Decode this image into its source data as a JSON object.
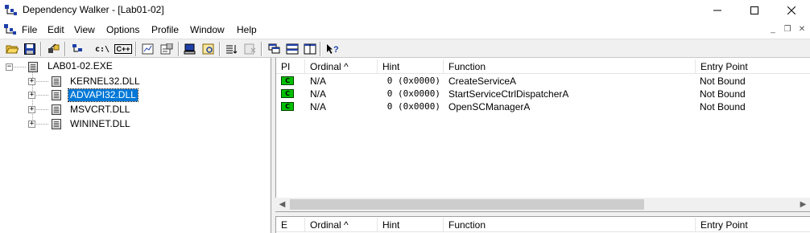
{
  "window": {
    "title": "Dependency Walker - [Lab01-02]",
    "minimize_icon": "minimize-icon",
    "maximize_icon": "maximize-icon",
    "close_icon": "close-icon"
  },
  "menu": {
    "items": [
      "File",
      "Edit",
      "View",
      "Options",
      "Profile",
      "Window",
      "Help"
    ]
  },
  "toolbar": {
    "buttons": [
      "open-icon",
      "save-icon",
      "find-icon",
      "copy-icon",
      "full-paths-icon",
      "undecorate-cpp-icon",
      "auto-expand-icon",
      "properties-icon",
      "system-info-icon",
      "view-module-icon",
      "sort-icon",
      "configure-icon",
      "cascade-icon",
      "tile-horizontal-icon",
      "tile-vertical-icon",
      "help-icon"
    ],
    "text_buttons": [
      "c:\\",
      "C++"
    ]
  },
  "tree": {
    "root": "LAB01-02.EXE",
    "children": [
      "KERNEL32.DLL",
      "ADVAPI32.DLL",
      "MSVCRT.DLL",
      "WININET.DLL"
    ],
    "selected": "ADVAPI32.DLL"
  },
  "imports": {
    "columns": [
      "PI",
      "Ordinal ^",
      "Hint",
      "Function",
      "Entry Point"
    ],
    "rows": [
      {
        "pi": "C",
        "ordinal": "N/A",
        "hint": "0 (0x0000)",
        "function": "CreateServiceA",
        "entry": "Not Bound"
      },
      {
        "pi": "C",
        "ordinal": "N/A",
        "hint": "0 (0x0000)",
        "function": "StartServiceCtrlDispatcherA",
        "entry": "Not Bound"
      },
      {
        "pi": "C",
        "ordinal": "N/A",
        "hint": "0 (0x0000)",
        "function": "OpenSCManagerA",
        "entry": "Not Bound"
      }
    ],
    "pi_color": "#00c000"
  },
  "exports": {
    "columns": [
      "E",
      "Ordinal ^",
      "Hint",
      "Function",
      "Entry Point"
    ]
  },
  "colors": {
    "selection": "#0078d7"
  }
}
